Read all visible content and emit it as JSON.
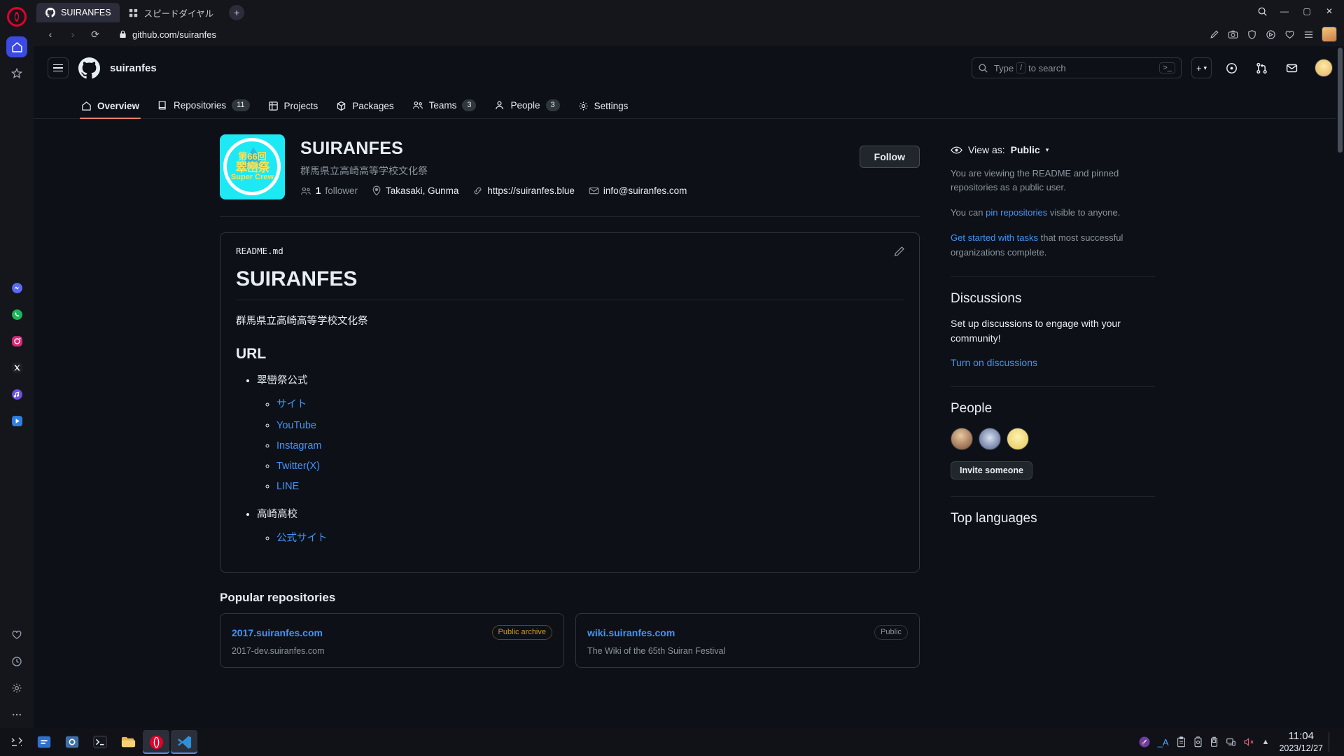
{
  "browser": {
    "tabs": [
      {
        "title": "SUIRANFES",
        "icon": "github-icon",
        "active": true
      },
      {
        "title": "スピードダイヤル",
        "icon": "speed-dial-icon",
        "active": false
      }
    ],
    "new_tab_label": "+",
    "window_controls": {
      "minimize": "—",
      "maximize": "▢",
      "close": "✕"
    },
    "search_icon": "search-icon",
    "address": {
      "url": "github.com/suiranfes",
      "lock_icon": "lock-icon",
      "back": "‹",
      "forward": "›",
      "reload": "⟳"
    }
  },
  "header": {
    "org_name": "suiranfes",
    "search_placeholder_prefix": "Type",
    "search_key": "/",
    "search_placeholder_suffix": "to search",
    "command_key": ">_",
    "create_label": "+",
    "create_caret": "▾"
  },
  "nav": {
    "items": [
      {
        "label": "Overview",
        "icon": "home-icon",
        "count": null,
        "active": true
      },
      {
        "label": "Repositories",
        "icon": "repo-icon",
        "count": "11",
        "active": false
      },
      {
        "label": "Projects",
        "icon": "project-icon",
        "count": null,
        "active": false
      },
      {
        "label": "Packages",
        "icon": "package-icon",
        "count": null,
        "active": false
      },
      {
        "label": "Teams",
        "icon": "people-icon",
        "count": "3",
        "active": false
      },
      {
        "label": "People",
        "icon": "person-icon",
        "count": "3",
        "active": false
      },
      {
        "label": "Settings",
        "icon": "gear-icon",
        "count": null,
        "active": false
      }
    ]
  },
  "profile": {
    "avatar": {
      "line1": "第66回",
      "line2": "翠巒祭",
      "line3": "Super Crew",
      "bg_color": "#1de9f5",
      "text_color": "#ffe14d"
    },
    "name": "SUIRANFES",
    "description": "群馬県立高崎高等学校文化祭",
    "followers_count": "1",
    "followers_label": "follower",
    "location": "Takasaki, Gunma",
    "website": "https://suiranfes.blue",
    "email": "info@suiranfes.com",
    "follow_button": "Follow"
  },
  "readme": {
    "filename": "README.md",
    "edit_icon": "pencil-icon",
    "heading": "SUIRANFES",
    "paragraph": "群馬県立高崎高等学校文化祭",
    "section_heading": "URL",
    "groups": [
      {
        "label": "翠巒祭公式",
        "links": [
          "サイト",
          "YouTube",
          "Instagram",
          "Twitter(X)",
          "LINE"
        ]
      },
      {
        "label": "高崎高校",
        "links": [
          "公式サイト"
        ]
      }
    ]
  },
  "popular": {
    "title": "Popular repositories",
    "repos": [
      {
        "name": "2017.suiranfes.com",
        "badge": "Public archive",
        "badge_type": "archive",
        "description": "2017-dev.suiranfes.com"
      },
      {
        "name": "wiki.suiranfes.com",
        "badge": "Public",
        "badge_type": "public",
        "description": "The Wiki of the 65th Suiran Festival"
      }
    ]
  },
  "sidebar": {
    "view_as_label": "View as:",
    "view_as_value": "Public",
    "view_as_caret": "▾",
    "eye_icon": "eye-icon",
    "notice_1": "You are viewing the README and pinned repositories as a public user.",
    "notice_2_pre": "You can ",
    "notice_2_link": "pin repositories",
    "notice_2_post": " visible to anyone.",
    "notice_3_link": "Get started with tasks",
    "notice_3_post": " that most successful organizations complete.",
    "discussions": {
      "title": "Discussions",
      "body": "Set up discussions to engage with your community!",
      "link": "Turn on discussions"
    },
    "people": {
      "title": "People",
      "avatars": [
        "member-avatar-1",
        "member-avatar-2",
        "member-avatar-3"
      ],
      "invite_button": "Invite someone"
    },
    "top_languages": {
      "title": "Top languages"
    }
  },
  "taskbar": {
    "start_icon": "start-icon",
    "apps": [
      {
        "name": "app-store-icon",
        "active": false
      },
      {
        "name": "settings-icon",
        "active": false
      },
      {
        "name": "terminal-icon",
        "active": false
      },
      {
        "name": "file-explorer-icon",
        "active": false
      },
      {
        "name": "opera-icon",
        "active": true
      },
      {
        "name": "vscode-icon",
        "active": true
      }
    ],
    "tray": [
      "ime-icon",
      "ime-mode-A",
      "clipboard-icon",
      "battery-icon",
      "usb-icon",
      "network-icon",
      "volume-muted-icon",
      "chevron-up-icon"
    ],
    "ime_mode": "_A",
    "time": "11:04",
    "date": "2023/12/27"
  },
  "opera_sidebar": {
    "items": [
      "opera-logo",
      "home-icon",
      "pinboard-icon",
      "messenger-icon",
      "whatsapp-icon",
      "instagram-icon",
      "x-twitter-icon",
      "music-icon",
      "player-icon",
      "heart-icon",
      "history-icon",
      "settings-icon",
      "more-icon"
    ]
  }
}
